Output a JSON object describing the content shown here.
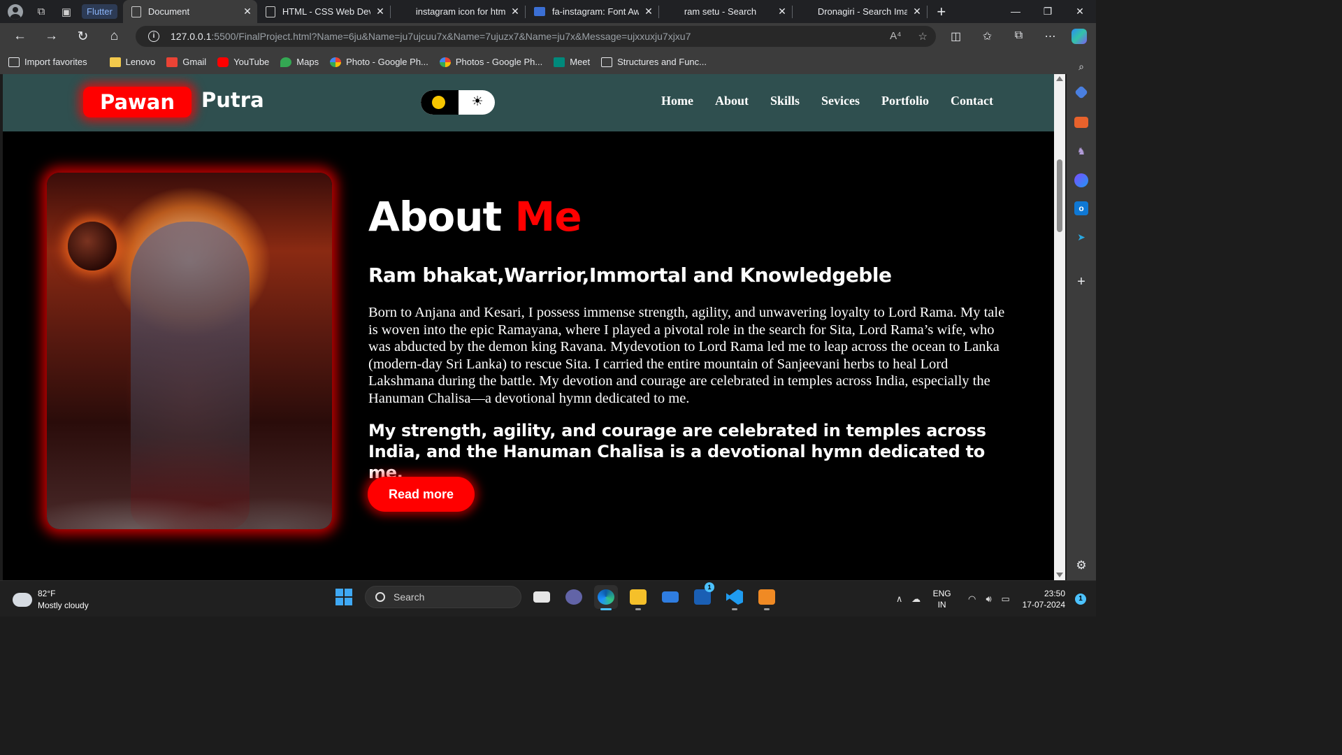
{
  "browser": {
    "tab_group": "Flutter",
    "tabs": [
      {
        "label": "Document",
        "active": true
      },
      {
        "label": "HTML - CSS Web Devel",
        "active": false
      },
      {
        "label": "instagram icon for htm",
        "active": false
      },
      {
        "label": "fa-instagram: Font Awe",
        "active": false
      },
      {
        "label": "ram setu - Search",
        "active": false
      },
      {
        "label": "Dronagiri - Search Imag",
        "active": false
      }
    ],
    "url_host": "127.0.0.1",
    "url_path": ":5500/FinalProject.html?Name=6ju&Name=ju7ujcuu7x&Name=7ujuzx7&Name=ju7x&Message=ujxxuxju7xjxu7",
    "favorites": [
      {
        "label": "Import favorites",
        "color": "#e8eaed"
      },
      {
        "label": "Lenovo",
        "color": "#f2c94c"
      },
      {
        "label": "Gmail",
        "color": "#ea4335"
      },
      {
        "label": "YouTube",
        "color": "#ff0000"
      },
      {
        "label": "Maps",
        "color": "#34a853"
      },
      {
        "label": "Photo - Google Ph...",
        "color": "#fbbc05"
      },
      {
        "label": "Photos - Google Ph...",
        "color": "#4285f4"
      },
      {
        "label": "Meet",
        "color": "#00897b"
      },
      {
        "label": "Structures and Func...",
        "color": "#e8eaed"
      }
    ]
  },
  "site": {
    "logo_first": "Pawan",
    "logo_second": "Putra",
    "nav": [
      "Home",
      "About",
      "Skills",
      "Sevices",
      "Portfolio",
      "Contact"
    ],
    "about": {
      "title_main": "About",
      "title_accent": "Me",
      "subtitle": "Ram bhakat,Warrior,Immortal and Knowledgeble",
      "paragraph": "Born to Anjana and Kesari, I possess immense strength, agility, and unwavering loyalty to Lord Rama. My tale is woven into the epic Ramayana, where I played a pivotal role in the search for Sita, Lord Rama’s wife, who was abducted by the demon king Ravana. Mydevotion to Lord Rama led me to leap across the ocean to Lanka (modern-day Sri Lanka) to rescue Sita. I carried the entire mountain of Sanjeevani herbs to heal Lord Lakshmana during the battle. My devotion and courage are celebrated in temples across India, especially the Hanuman Chalisa—a devotional hymn dedicated to me.",
      "bold_text": "My strength, agility, and courage are celebrated in temples across India, and the Hanuman Chalisa is a devotional hymn dedicated to me.",
      "button": "Read more"
    },
    "colors": {
      "accent": "#ff0000",
      "header_bg": "#2f4f4f",
      "page_bg": "#000000"
    }
  },
  "taskbar": {
    "temperature": "82°F",
    "weather": "Mostly cloudy",
    "search_label": "Search",
    "lang_top": "ENG",
    "lang_bottom": "IN",
    "time": "23:50",
    "date": "17-07-2024",
    "outlook_badge": "1",
    "notification_count": "1"
  }
}
